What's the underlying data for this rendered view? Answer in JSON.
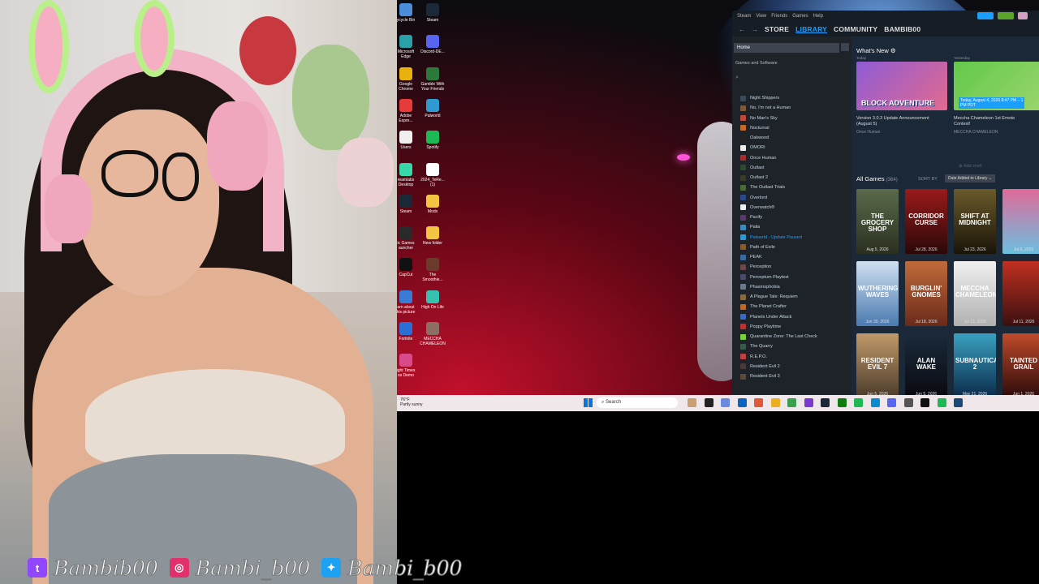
{
  "overlay": {
    "handles": [
      {
        "platform": "twitch-icon",
        "glyph": "t",
        "color": "#9146ff",
        "handle": "Bambib00"
      },
      {
        "platform": "instagram-icon",
        "glyph": "◎",
        "color": "#e1306c",
        "handle": "Bambi_b00"
      },
      {
        "platform": "twitter-icon",
        "glyph": "✦",
        "color": "#1da1f2",
        "handle": "Bambi_b00"
      }
    ]
  },
  "desktop": {
    "icons": [
      {
        "label": "ycycle Bin",
        "color": "#4a8dd9"
      },
      {
        "label": "Steam",
        "color": "#1b2838"
      },
      {
        "label": "Microsoft\nEdge",
        "color": "#2aa0a8"
      },
      {
        "label": "Discord-DE...",
        "color": "#5865f2"
      },
      {
        "label": "Google\nChrome",
        "color": "#e8b20e"
      },
      {
        "label": "Gamble With\nYour Friends",
        "color": "#2c7a3a"
      },
      {
        "label": "Adobe\nExpre...",
        "color": "#e63b3b"
      },
      {
        "label": "Palworld",
        "color": "#2e9ad0"
      },
      {
        "label": "Users",
        "color": "#f0f0f0"
      },
      {
        "label": "Spotify",
        "color": "#1db954"
      },
      {
        "label": "reamlabs\nDesktop",
        "color": "#38d9a9"
      },
      {
        "label": "2024_TeRe...\n(1)",
        "color": "#ffffff"
      },
      {
        "label": "Steam",
        "color": "#1b2838"
      },
      {
        "label": "Mods",
        "color": "#f4c542"
      },
      {
        "label": "ic Games\nauncher",
        "color": "#2a2a2a"
      },
      {
        "label": "New folder",
        "color": "#f4c542"
      },
      {
        "label": "CapCut",
        "color": "#111111"
      },
      {
        "label": "The\nSmoothie...",
        "color": "#6b3a2a"
      },
      {
        "label": "arn about\nhis picture",
        "color": "#3a7bd5"
      },
      {
        "label": "High On Life",
        "color": "#35c3b0"
      },
      {
        "label": "Fortnite",
        "color": "#2a6fd6"
      },
      {
        "label": "MECCHA\nCHAMELEON",
        "color": "#8d6e63"
      },
      {
        "label": "ight Times\nss Demo",
        "color": "#d94a8a"
      }
    ]
  },
  "steam": {
    "menu": [
      "Steam",
      "View",
      "Friends",
      "Games",
      "Help"
    ],
    "nav": {
      "store": "STORE",
      "library": "LIBRARY",
      "community": "COMMUNITY",
      "user": "BAMBIB00"
    },
    "sidebar": {
      "home": "Home",
      "filter": "Games and Software",
      "games": [
        {
          "name": "Night Shippers",
          "color": "#3a4a5a"
        },
        {
          "name": "No, I'm not a Human",
          "color": "#7a5a3a"
        },
        {
          "name": "No Man's Sky",
          "color": "#c04a3a"
        },
        {
          "name": "Nocturnal",
          "color": "#c66a2a"
        },
        {
          "name": "Oakwood",
          "color": "#222222"
        },
        {
          "name": "OMORI",
          "color": "#eeeeee"
        },
        {
          "name": "Once Human",
          "color": "#a33030"
        },
        {
          "name": "Outlast",
          "color": "#2e4a2e"
        },
        {
          "name": "Outlast 2",
          "color": "#3a3a2a"
        },
        {
          "name": "The Outlast Trials",
          "color": "#4a6a3a"
        },
        {
          "name": "Overlord",
          "color": "#2a4a8a"
        },
        {
          "name": "Overwatch®",
          "color": "#f0f0f0"
        },
        {
          "name": "Pacify",
          "color": "#5a3a6a"
        },
        {
          "name": "Palia",
          "color": "#3a8ac0"
        },
        {
          "name": "Palworld - Update Paused",
          "color": "#2e9ad0",
          "update": true
        },
        {
          "name": "Path of Exile",
          "color": "#8a5a2a"
        },
        {
          "name": "PEAK",
          "color": "#3a6aa0"
        },
        {
          "name": "Perception",
          "color": "#6a4a4a"
        },
        {
          "name": "Perceptum Playtest",
          "color": "#4a4a6a"
        },
        {
          "name": "Phasmophobia",
          "color": "#6a7a8a"
        },
        {
          "name": "A Plague Tale: Requiem",
          "color": "#8a6a3a"
        },
        {
          "name": "The Planet Crafter",
          "color": "#c06a2a"
        },
        {
          "name": "Planets Under Attack",
          "color": "#3a6ac0"
        },
        {
          "name": "Poppy Playtime",
          "color": "#c03030"
        },
        {
          "name": "Quarantine Zone: The Last Check",
          "color": "#7ad03a"
        },
        {
          "name": "The Quarry",
          "color": "#3a5a4a"
        },
        {
          "name": "R.E.P.O.",
          "color": "#c04040"
        },
        {
          "name": "Resident Evil 2",
          "color": "#4a3a3a"
        },
        {
          "name": "Resident Evil 3",
          "color": "#5a4a3a"
        }
      ]
    },
    "whats_new": {
      "title": "What's New ⚙",
      "cards": [
        {
          "when": "Today",
          "art_text": "BLOCK ADVENTURE",
          "caption": "Version 3.0.3 Update Announcement\n(August 5)",
          "source": "Once Human",
          "c1": "#8e5bd6",
          "c2": "#e36a8e"
        },
        {
          "when": "Yesterday",
          "art_text": "Today, August 4, 2026 8:47 PM – 1\nPM PDT",
          "caption": "Meccha Chameleon 1st Emote\nContest!",
          "source": "MECCHA CHAMELEON",
          "c1": "#62c94a",
          "c2": "#9bd56e"
        }
      ],
      "add_shelf": "⊕ Add shelf"
    },
    "all_games": {
      "label": "All Games",
      "count": "(364)",
      "sort_label": "SORT BY",
      "sort_value": "Date Added to Library ⌄",
      "tiles": [
        {
          "name": "THE GROCERY SHOP",
          "date": "Aug 5, 2026",
          "c1": "#5a6a4a",
          "c2": "#2a3020"
        },
        {
          "name": "CORRIDOR CURSE",
          "date": "Jul 28, 2026",
          "c1": "#9a1a1a",
          "c2": "#2a0808"
        },
        {
          "name": "SHIFT AT MIDNIGHT",
          "date": "Jul 23, 2026",
          "c1": "#6a5a2a",
          "c2": "#1a1408"
        },
        {
          "name": "",
          "date": "Jul 9, 2026",
          "c1": "#e06a9a",
          "c2": "#6ac0e0"
        },
        {
          "name": "WUTHERING WAVES",
          "date": "Jun 30, 2026",
          "c1": "#d0e0f0",
          "c2": "#4a7ab0"
        },
        {
          "name": "BURGLIN' GNOMES",
          "date": "Jul 18, 2026",
          "c1": "#c06a3a",
          "c2": "#6a2a1a"
        },
        {
          "name": "MECCHA CHAMELEON",
          "date": "Jul 13, 2026",
          "c1": "#f0f0f0",
          "c2": "#b0b0b0"
        },
        {
          "name": "",
          "date": "Jul 11, 2026",
          "c1": "#c03020",
          "c2": "#3a1010"
        },
        {
          "name": "RESIDENT EVIL 7",
          "date": "Jun 5, 2026",
          "c1": "#c09a6a",
          "c2": "#4a3a2a"
        },
        {
          "name": "ALAN WAKE",
          "date": "Jun 5, 2026",
          "c1": "#1a2a3a",
          "c2": "#0a0a10"
        },
        {
          "name": "SUBNAUTICA 2",
          "date": "May 21, 2026",
          "c1": "#3aa0c0",
          "c2": "#0a2a4a"
        },
        {
          "name": "TAINTED GRAIL",
          "date": "Jun 1, 2026",
          "c1": "#c04a2a",
          "c2": "#2a0a0a"
        }
      ]
    }
  },
  "taskbar": {
    "temperature": "76°F",
    "condition": "Partly sunny",
    "search_placeholder": "Search",
    "apps": [
      {
        "name": "widgets-icon",
        "color": "#caa070"
      },
      {
        "name": "task-view-icon",
        "color": "#222222"
      },
      {
        "name": "copilot-icon",
        "color": "#6a8ae0"
      },
      {
        "name": "outlook-icon",
        "color": "#0a64c0"
      },
      {
        "name": "media-icon",
        "color": "#e05a3a"
      },
      {
        "name": "file-explorer-icon",
        "color": "#e8b020"
      },
      {
        "name": "chrome-icon",
        "color": "#3aa050"
      },
      {
        "name": "clipchamp-icon",
        "color": "#7a3ad0"
      },
      {
        "name": "steam-icon",
        "color": "#1b2838"
      },
      {
        "name": "xbox-icon",
        "color": "#107c10"
      },
      {
        "name": "spotify-icon",
        "color": "#1db954"
      },
      {
        "name": "edge-icon",
        "color": "#0a8ad0"
      },
      {
        "name": "discord-icon",
        "color": "#5865f2"
      },
      {
        "name": "camera-icon",
        "color": "#555555"
      },
      {
        "name": "capcut-icon",
        "color": "#111111"
      },
      {
        "name": "xbox-bar-icon",
        "color": "#1db954"
      },
      {
        "name": "steam-pinned-icon",
        "color": "#1b4a78"
      }
    ]
  }
}
